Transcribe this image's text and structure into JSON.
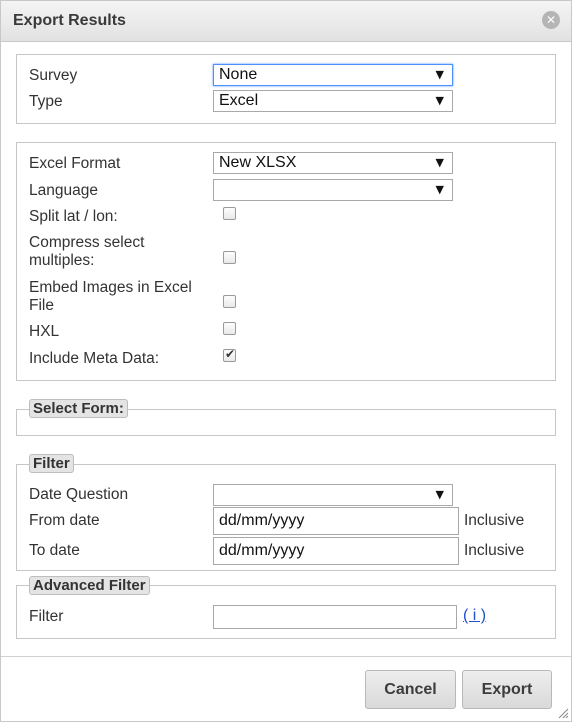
{
  "dialog": {
    "title": "Export Results",
    "close_icon": "close-icon"
  },
  "basic": {
    "survey_label": "Survey",
    "survey_value": "None",
    "type_label": "Type",
    "type_value": "Excel"
  },
  "excel": {
    "format_label": "Excel Format",
    "format_value": "New XLSX",
    "language_label": "Language",
    "language_value": "",
    "split_label": "Split lat / lon:",
    "split_checked": false,
    "compress_label_1": "Compress select",
    "compress_label_2": "multiples:",
    "compress_checked": false,
    "embed_label_1": "Embed Images in Excel",
    "embed_label_2": "File",
    "embed_checked": false,
    "hxl_label": "HXL",
    "hxl_checked": false,
    "meta_label": "Include Meta Data:",
    "meta_checked": true
  },
  "select_form": {
    "legend": "Select Form:"
  },
  "filter": {
    "legend": "Filter",
    "date_question_label": "Date Question",
    "date_question_value": "",
    "from_label": "From date",
    "from_value": "dd/mm/yyyy",
    "from_inclusive": "Inclusive",
    "to_label": "To date",
    "to_value": "dd/mm/yyyy",
    "to_inclusive": "Inclusive"
  },
  "advanced": {
    "legend": "Advanced Filter",
    "filter_label": "Filter",
    "filter_value": "",
    "info_link": "( i )"
  },
  "buttons": {
    "cancel": "Cancel",
    "export": "Export"
  },
  "colors": {
    "focus_border": "#4d90fe",
    "link": "#1f4fcf"
  },
  "glyphs": {
    "dropdown_arrow": "▼",
    "check": "✔",
    "close": "✕"
  }
}
